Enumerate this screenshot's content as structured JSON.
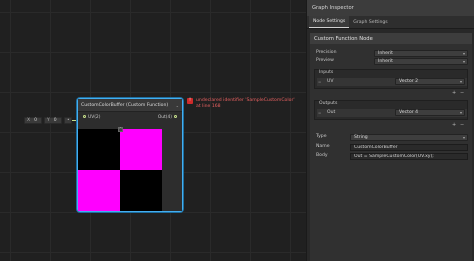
{
  "canvas_inputs": {
    "x_label": "X",
    "x_value": "0",
    "y_label": "Y",
    "y_value": "0"
  },
  "node": {
    "title": "CustomColorBuffer (Custom Function)",
    "collapse_glyph": "⌄",
    "input_port": "UV(2)",
    "output_port": "Out(4)",
    "preview_toggle_glyph": "^"
  },
  "error": {
    "icon": "!",
    "message": "undeclared identifier 'SampleCustomColor' at line 168"
  },
  "inspector": {
    "title": "Graph Inspector",
    "tabs": [
      "Node Settings",
      "Graph Settings"
    ],
    "section_title": "Custom Function Node",
    "precision_label": "Precision",
    "precision_value": "Inherit",
    "preview_label": "Preview",
    "preview_value": "Inherit",
    "inputs_label": "Inputs",
    "input_name": "UV",
    "input_type": "Vector 2",
    "outputs_label": "Outputs",
    "output_name": "Out",
    "output_type": "Vector 4",
    "type_label": "Type",
    "type_value": "String",
    "name_label": "Name",
    "name_value": "CustomColorBuffer",
    "body_label": "Body",
    "body_value": "Out = SampleCustomColor(UV.xy);",
    "plus": "+",
    "minus": "−",
    "equals": "="
  },
  "colors": {
    "accent": "#44aef0",
    "error": "#e86060",
    "magenta": "#ff00ff",
    "wire": "#c7e08b"
  }
}
